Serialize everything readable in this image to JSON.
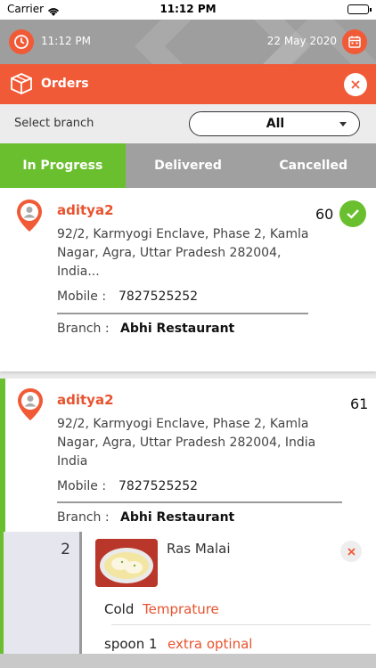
{
  "status_bar": {
    "carrier": "Carrier",
    "time": "11:12 PM"
  },
  "header": {
    "time": "11:12 PM",
    "date": "22 May 2020"
  },
  "orders_bar": {
    "title": "Orders"
  },
  "branch": {
    "label": "Select branch",
    "selected": "All"
  },
  "tabs": [
    {
      "label": "In Progress",
      "active": true
    },
    {
      "label": "Delivered",
      "active": false
    },
    {
      "label": "Cancelled",
      "active": false
    }
  ],
  "orders": [
    {
      "name": "aditya2",
      "address_lines": [
        "92/2, Karmyogi Enclave, Phase 2, Kamla",
        "Nagar, Agra, Uttar Pradesh 282004,",
        "India..."
      ],
      "mobile_label": "Mobile :",
      "mobile": "7827525252",
      "branch_label": "Branch :",
      "branch": "Abhi Restaurant",
      "order_no": "60",
      "status_icon": "check-icon"
    },
    {
      "name": "aditya2",
      "address_lines": [
        "92/2, Karmyogi Enclave, Phase 2, Kamla",
        "Nagar, Agra, Uttar Pradesh 282004, India",
        "India"
      ],
      "mobile_label": "Mobile :",
      "mobile": "7827525252",
      "branch_label": "Branch :",
      "branch": "Abhi Restaurant",
      "order_no": "61",
      "item": {
        "qty": "2",
        "name": "Ras Malai",
        "options": [
          {
            "key": "Cold",
            "value": "Temprature"
          },
          {
            "key": "spoon 1",
            "value": "extra optinal"
          }
        ]
      }
    }
  ],
  "colors": {
    "accent": "#f15a37",
    "green": "#6abf2e",
    "header_grey": "#9e9e9e"
  }
}
